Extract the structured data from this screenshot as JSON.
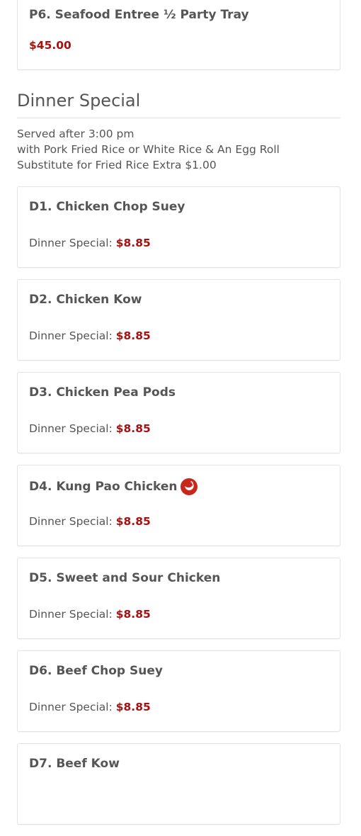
{
  "top_item": {
    "name": "P6. Seafood Entree ½ Party Tray",
    "price": "$45.00"
  },
  "section": {
    "title": "Dinner Special",
    "description": [
      "Served after 3:00 pm",
      "with Pork Fried Rice or White Rice & An Egg Roll",
      "Substitute for Fried Rice Extra $1.00"
    ]
  },
  "items": [
    {
      "name": "D1. Chicken Chop Suey",
      "price_label": "Dinner Special:",
      "price": "$8.85",
      "spicy": false
    },
    {
      "name": "D2. Chicken Kow",
      "price_label": "Dinner Special:",
      "price": "$8.85",
      "spicy": false
    },
    {
      "name": "D3. Chicken Pea Pods",
      "price_label": "Dinner Special:",
      "price": "$8.85",
      "spicy": false
    },
    {
      "name": "D4. Kung Pao Chicken",
      "price_label": "Dinner Special:",
      "price": "$8.85",
      "spicy": true,
      "icon": "hot-pepper-icon"
    },
    {
      "name": "D5. Sweet and Sour Chicken",
      "price_label": "Dinner Special:",
      "price": "$8.85",
      "spicy": false
    },
    {
      "name": "D6. Beef Chop Suey",
      "price_label": "Dinner Special:",
      "price": "$8.85",
      "spicy": false
    },
    {
      "name": "D7. Beef Kow",
      "price_label": "",
      "price": "",
      "spicy": false
    }
  ],
  "colors": {
    "price": "#a81010",
    "text": "#555555",
    "spicy_icon": "#c8281c"
  }
}
